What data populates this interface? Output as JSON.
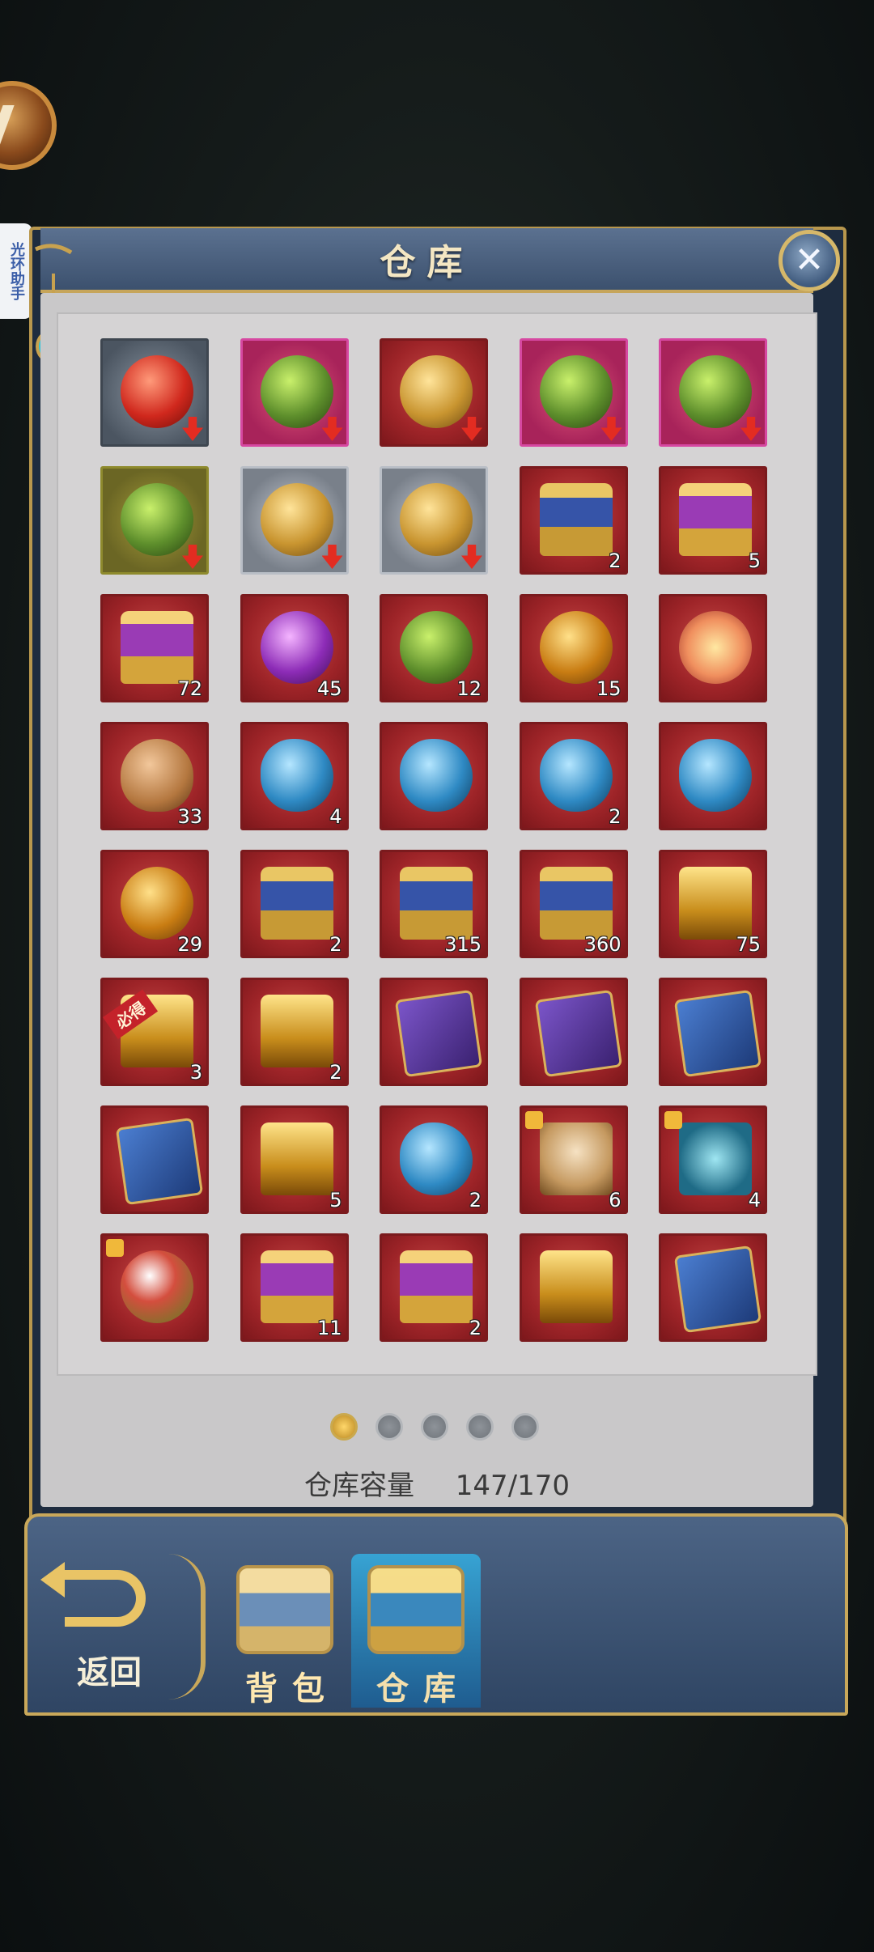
{
  "helper": {
    "label": "光环助手"
  },
  "window": {
    "title": "仓库",
    "close_icon": "✕"
  },
  "items": [
    {
      "bg": "gray",
      "icon": "red",
      "arrow": true,
      "count": ""
    },
    {
      "bg": "pink",
      "icon": "green",
      "arrow": true,
      "count": ""
    },
    {
      "bg": "red",
      "icon": "gold",
      "arrow": true,
      "count": ""
    },
    {
      "bg": "pink",
      "icon": "green",
      "arrow": true,
      "count": ""
    },
    {
      "bg": "pink",
      "icon": "green",
      "arrow": true,
      "count": ""
    },
    {
      "bg": "olive",
      "icon": "green",
      "arrow": true,
      "count": ""
    },
    {
      "bg": "silver",
      "icon": "gold",
      "arrow": true,
      "count": ""
    },
    {
      "bg": "silver",
      "icon": "gold",
      "arrow": true,
      "count": ""
    },
    {
      "bg": "red",
      "icon": "chest",
      "arrow": false,
      "count": "2"
    },
    {
      "bg": "red",
      "icon": "chestpurple",
      "arrow": false,
      "count": "5"
    },
    {
      "bg": "red",
      "icon": "chestpurple",
      "arrow": false,
      "count": "72"
    },
    {
      "bg": "red",
      "icon": "purple",
      "arrow": false,
      "count": "45"
    },
    {
      "bg": "red",
      "icon": "green",
      "arrow": false,
      "count": "12"
    },
    {
      "bg": "red",
      "icon": "orb",
      "arrow": false,
      "count": "15"
    },
    {
      "bg": "red",
      "icon": "lotus",
      "arrow": false,
      "count": ""
    },
    {
      "bg": "red",
      "icon": "pouch",
      "arrow": false,
      "count": "33"
    },
    {
      "bg": "red",
      "icon": "blue",
      "arrow": false,
      "count": "4"
    },
    {
      "bg": "red",
      "icon": "blue",
      "arrow": false,
      "count": ""
    },
    {
      "bg": "red",
      "icon": "blue",
      "arrow": false,
      "count": "2"
    },
    {
      "bg": "red",
      "icon": "blue",
      "arrow": false,
      "count": ""
    },
    {
      "bg": "red",
      "icon": "orb",
      "arrow": false,
      "count": "29"
    },
    {
      "bg": "red",
      "icon": "chest",
      "arrow": false,
      "count": "2"
    },
    {
      "bg": "red",
      "icon": "chest",
      "arrow": false,
      "count": "315"
    },
    {
      "bg": "red",
      "icon": "chest",
      "arrow": false,
      "count": "360"
    },
    {
      "bg": "red",
      "icon": "chestgold",
      "arrow": false,
      "count": "75"
    },
    {
      "bg": "red",
      "icon": "chestgold",
      "arrow": false,
      "count": "3",
      "badge": "必得"
    },
    {
      "bg": "red",
      "icon": "chestgold",
      "arrow": false,
      "count": "2"
    },
    {
      "bg": "red",
      "icon": "card",
      "arrow": false,
      "count": ""
    },
    {
      "bg": "red",
      "icon": "card",
      "arrow": false,
      "count": ""
    },
    {
      "bg": "red",
      "icon": "cardblue",
      "arrow": false,
      "count": ""
    },
    {
      "bg": "red",
      "icon": "cardblue",
      "arrow": false,
      "count": ""
    },
    {
      "bg": "red",
      "icon": "chestgold",
      "arrow": false,
      "count": "5"
    },
    {
      "bg": "red",
      "icon": "blue",
      "arrow": false,
      "count": "2"
    },
    {
      "bg": "red",
      "icon": "portrait",
      "arrow": false,
      "count": "6",
      "puzzle": true
    },
    {
      "bg": "red",
      "icon": "plant",
      "arrow": false,
      "count": "4",
      "puzzle": true
    },
    {
      "bg": "red",
      "icon": "bell",
      "arrow": false,
      "count": "",
      "puzzle": true
    },
    {
      "bg": "red",
      "icon": "chestpurple",
      "arrow": false,
      "count": "11"
    },
    {
      "bg": "red",
      "icon": "chestpurple",
      "arrow": false,
      "count": "2"
    },
    {
      "bg": "red",
      "icon": "chestgold",
      "arrow": false,
      "count": ""
    },
    {
      "bg": "red",
      "icon": "cardblue",
      "arrow": false,
      "count": ""
    }
  ],
  "pagination": {
    "total": 5,
    "active_index": 0
  },
  "capacity": {
    "label": "仓库容量",
    "value": "147/170"
  },
  "bottom": {
    "back_label": "返回",
    "tab_bag": "背包",
    "tab_warehouse": "仓库",
    "active_tab": "warehouse"
  }
}
